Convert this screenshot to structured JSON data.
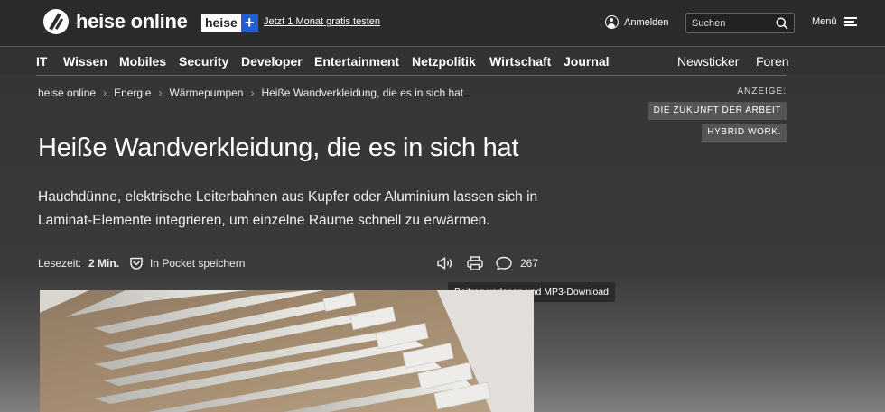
{
  "header": {
    "logo_text": "heise online",
    "plus_badge_text": "heise",
    "plus_badge_symbol": "+",
    "promo_link": "Jetzt 1 Monat gratis testen",
    "login_label": "Anmelden",
    "search_placeholder": "Suchen",
    "menu_label": "Menü"
  },
  "nav": {
    "left_items": [
      "IT",
      "Wissen",
      "Mobiles",
      "Security",
      "Developer",
      "Entertainment",
      "Netzpolitik",
      "Wirtschaft",
      "Journal"
    ],
    "right_items": [
      "Newsticker",
      "Foren"
    ]
  },
  "breadcrumb": [
    "heise online",
    "Energie",
    "Wärmepumpen",
    "Heiße Wandverkleidung, die es in sich hat"
  ],
  "ad": {
    "label": "ANZEIGE:",
    "chip_1": "DIE ZUKUNFT DER ARBEIT",
    "chip_2": "HYBRID WORK."
  },
  "article": {
    "title": "Heiße Wandverkleidung, die es in sich hat",
    "lead": "Hauchdünne, elektrische Leiterbahnen aus Kupfer oder Aluminium lassen sich in Laminat-Elemente integrieren, um einzelne Räume schnell zu erwärmen.",
    "reading_time_label": "Lesezeit:",
    "reading_time_value": "2 Min.",
    "pocket_label": "In Pocket speichern",
    "comment_count": "267",
    "tooltip": "Beitrag vorlesen und MP3-Download"
  },
  "icons": {
    "logo": "heise-logo-icon",
    "user": "user-icon",
    "search": "search-icon",
    "menu": "hamburger-icon",
    "pocket": "pocket-icon",
    "speaker": "speaker-icon",
    "print": "print-icon",
    "comment": "comment-icon"
  },
  "colors": {
    "header_bg": "#2b2b2b",
    "plus_blue": "#1f5fd1",
    "ad_chip_bg": "#555555"
  }
}
